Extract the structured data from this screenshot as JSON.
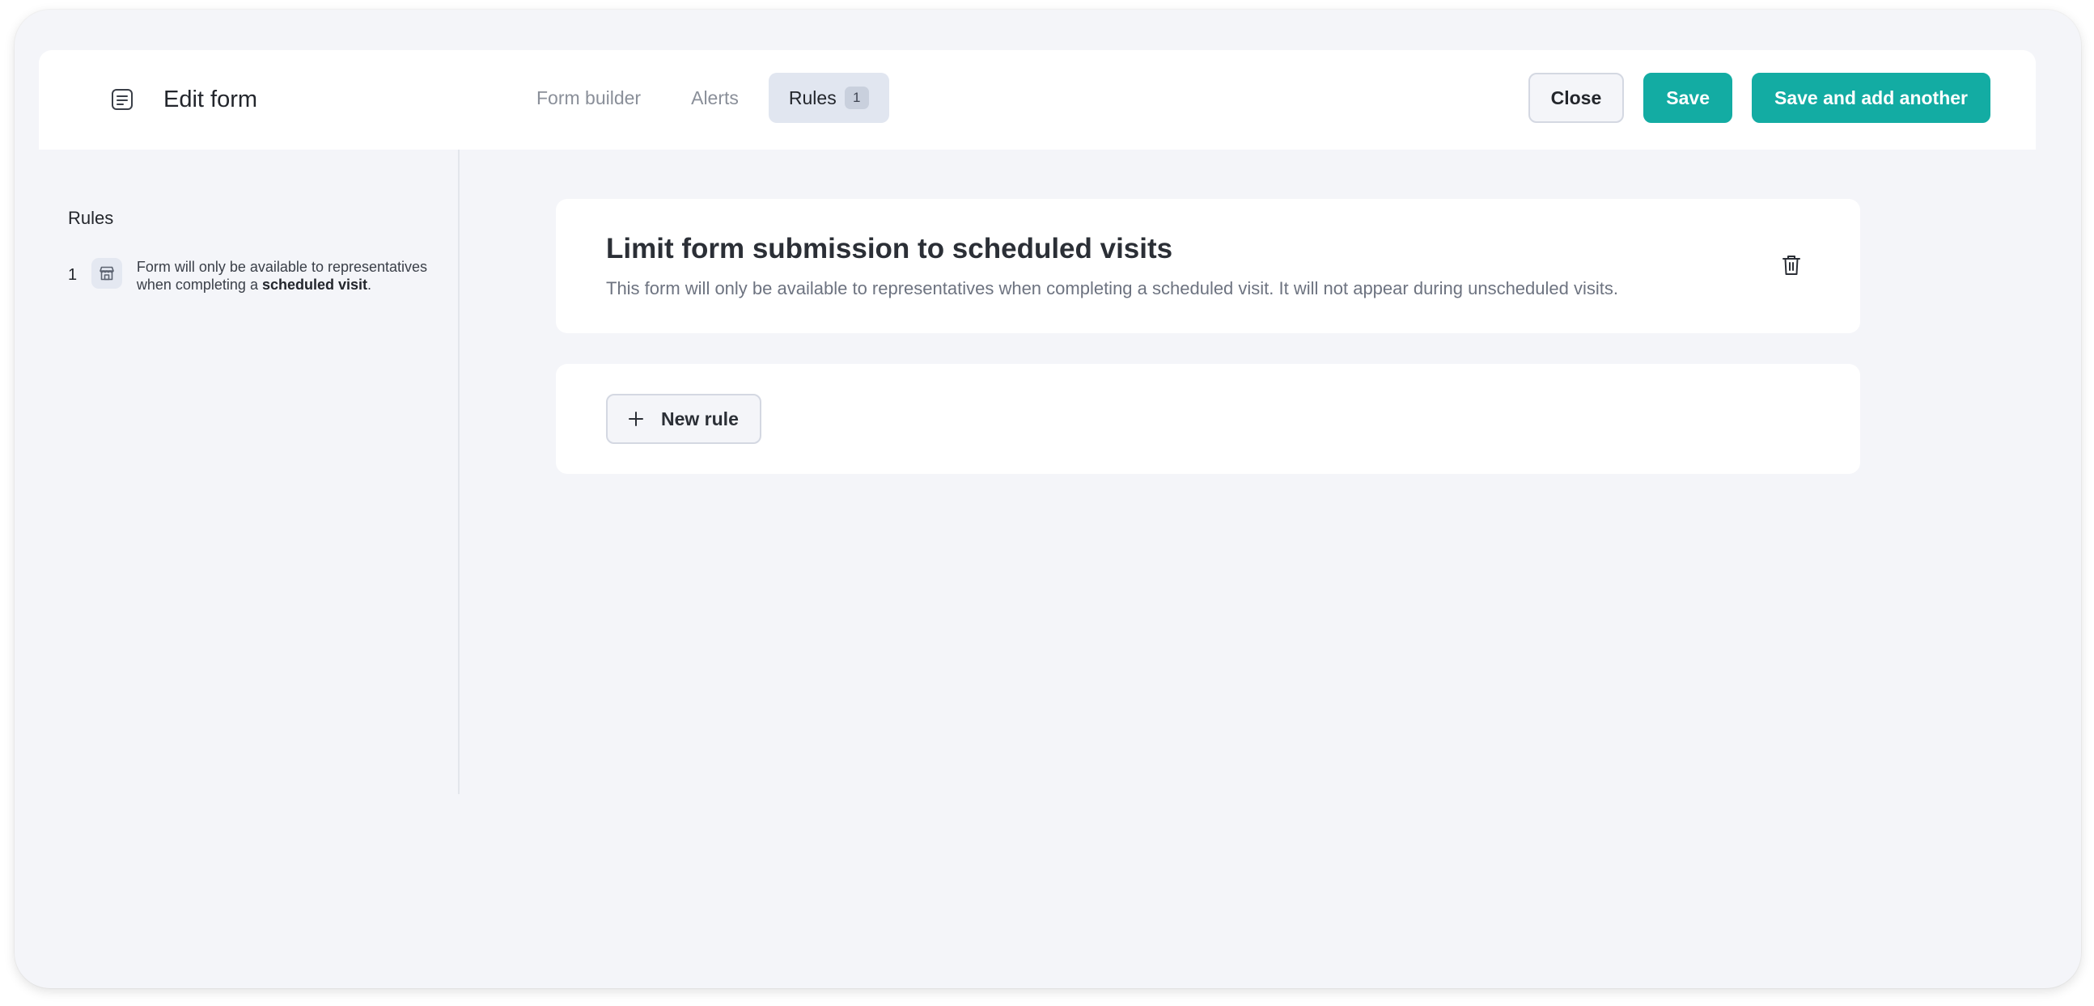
{
  "header": {
    "title": "Edit form",
    "tabs": [
      {
        "label": "Form builder",
        "active": false
      },
      {
        "label": "Alerts",
        "active": false
      },
      {
        "label": "Rules",
        "active": true,
        "count": "1"
      }
    ],
    "actions": {
      "close_label": "Close",
      "save_label": "Save",
      "save_add_label": "Save and add another"
    }
  },
  "sidebar": {
    "title": "Rules",
    "items": [
      {
        "number": "1",
        "text_prefix": "Form will only be available to representatives when completing a",
        "text_bold": "scheduled visit",
        "text_suffix": "."
      }
    ]
  },
  "main": {
    "rule_card": {
      "title": "Limit form submission to scheduled visits",
      "description": "This form will only be available to representatives when completing a scheduled visit. It will not appear during unscheduled visits."
    },
    "new_rule_label": "New rule"
  },
  "colors": {
    "accent": "#13aca3",
    "background": "#f4f5f9",
    "tab_active_bg": "#e1e6f0"
  }
}
